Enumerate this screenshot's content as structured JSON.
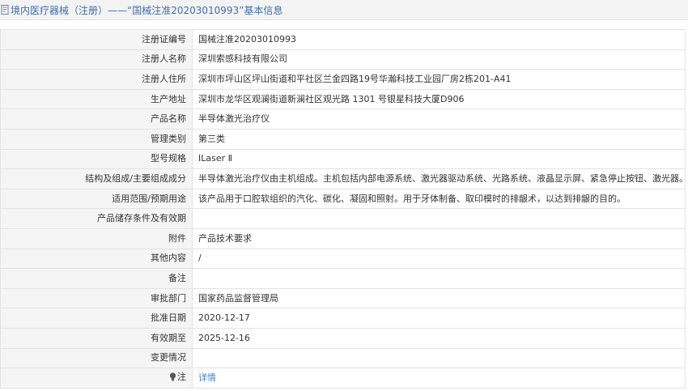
{
  "header": {
    "icon": "document-icon",
    "title": "境内医疗器械（注册）——“国械注准20203010993”基本信息"
  },
  "rows": [
    {
      "label": "注册证编号",
      "value": "国械注准20203010993"
    },
    {
      "label": "注册人名称",
      "value": "深圳索感科技有限公司"
    },
    {
      "label": "注册人住所",
      "value": "深圳市坪山区坪山街道和平社区兰金四路19号华瀚科技工业园厂房2栋201-A41"
    },
    {
      "label": "生产地址",
      "value": "深圳市龙华区观澜街道新澜社区观光路 1301 号银星科技大厦D906"
    },
    {
      "label": "产品名称",
      "value": "半导体激光治疗仪"
    },
    {
      "label": "管理类别",
      "value": "第三类"
    },
    {
      "label": "型号规格",
      "value": "ILaser Ⅱ"
    },
    {
      "label": "结构及组成/主要组成成分",
      "value": "半导体激光治疗仪由主机组成。主机包括内部电源系统、激光器驱动系统、光路系统、液晶显示屏、紧急停止按钮、激光器。"
    },
    {
      "label": "适用范围/预期用途",
      "value": "该产品用于口腔软组织的汽化、碳化、凝固和照射。用于牙体制备、取印模时的排龈术，以达到排龈的目的。"
    },
    {
      "label": "产品储存条件及有效期",
      "value": ""
    },
    {
      "label": "附件",
      "value": "产品技术要求"
    },
    {
      "label": "其他内容",
      "value": "/"
    },
    {
      "label": "备注",
      "value": ""
    },
    {
      "label": "审批部门",
      "value": "国家药品监督管理局"
    },
    {
      "label": "批准日期",
      "value": "2020-12-17"
    },
    {
      "label": "有效期至",
      "value": "2025-12-16"
    },
    {
      "label": "变更情况",
      "value": ""
    }
  ],
  "note_row": {
    "icon": "lightbulb-icon",
    "label": "注",
    "link_text": "详情"
  },
  "colors": {
    "header_text": "#3d6fb0",
    "link": "#3d7fc9",
    "label_bg": "#f5f5f5",
    "border": "#e3e3e3"
  }
}
